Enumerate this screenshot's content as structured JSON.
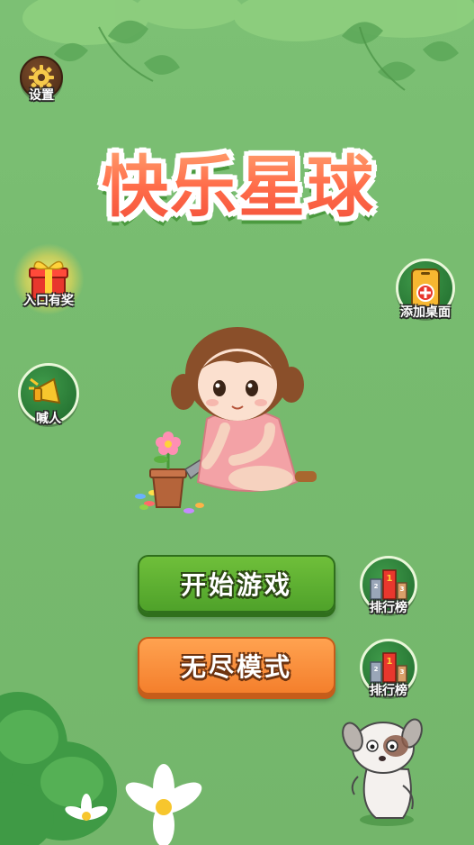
{
  "game": {
    "title": "快乐星球"
  },
  "top_left": {
    "settings_label": "设置",
    "settings_icon": "gear-icon"
  },
  "side_left": {
    "gift_label": "入口有奖",
    "gift_icon": "gift-box-icon",
    "shout_label": "喊人",
    "shout_icon": "megaphone-icon"
  },
  "side_right": {
    "add_desktop_label": "添加桌面",
    "add_desktop_icon": "phone-plus-icon"
  },
  "menu": {
    "start_label": "开始游戏",
    "endless_label": "无尽模式",
    "rank_label_1": "排行榜",
    "rank_label_2": "排行榜",
    "rank_icon": "leaderboard-icon"
  },
  "colors": {
    "background": "#77bb6f",
    "start_button": "#5bb030",
    "endless_button": "#f78a35",
    "title_fill": "#ff6d4a"
  }
}
